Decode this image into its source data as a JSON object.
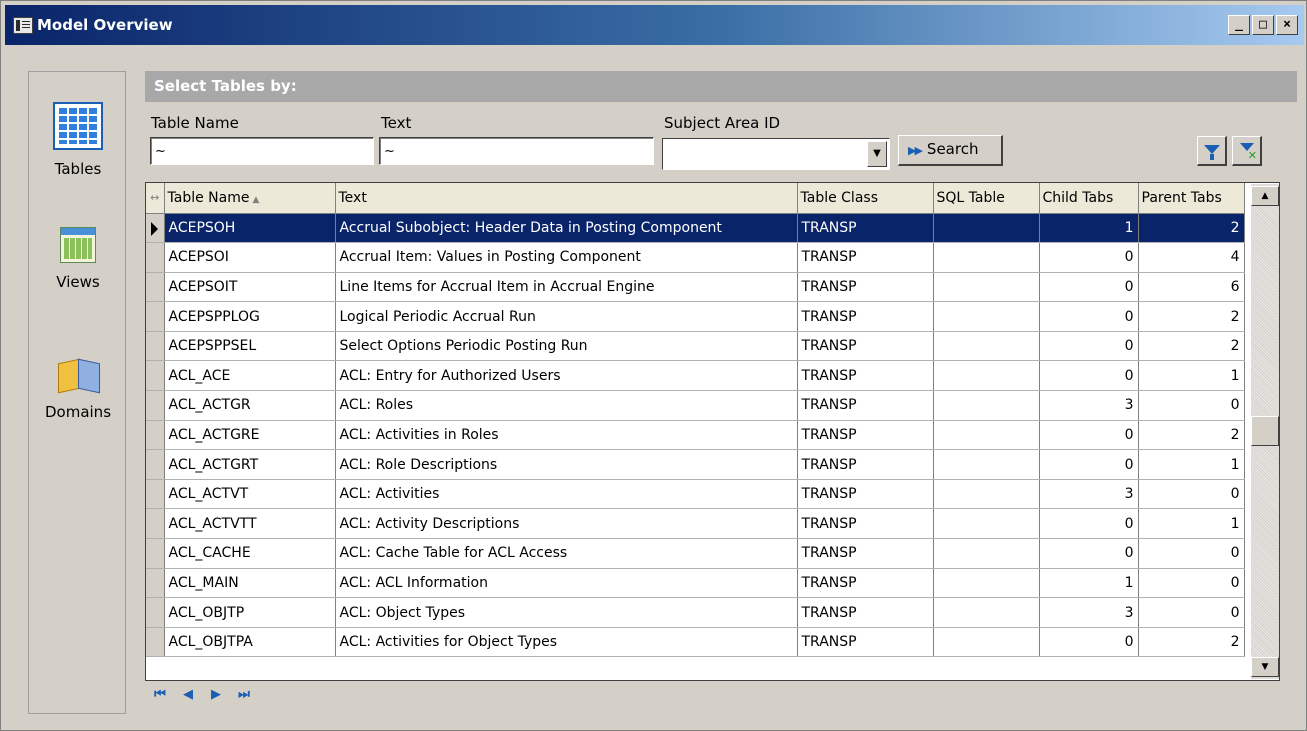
{
  "window": {
    "title": "Model Overview",
    "minimize": "_",
    "maximize": "□",
    "close": "×"
  },
  "leftnav": {
    "items": [
      {
        "label": "Tables",
        "icon": "tables-icon"
      },
      {
        "label": "Views",
        "icon": "views-icon"
      },
      {
        "label": "Domains",
        "icon": "domains-icon"
      }
    ]
  },
  "filter": {
    "header": "Select Tables by:",
    "table_name_label": "Table Name",
    "table_name_value": "~",
    "text_label": "Text",
    "text_value": "~",
    "subject_area_label": "Subject Area ID",
    "subject_area_value": "",
    "search_label": "Search"
  },
  "grid": {
    "columns": [
      "Table Name",
      "Text",
      "Table Class",
      "SQL Table",
      "Child Tabs",
      "Parent Tabs"
    ],
    "rows": [
      {
        "name": "ACEPSOH",
        "text": "Accrual Subobject: Header Data in Posting Component",
        "class": "TRANSP",
        "sql": "",
        "child": "1",
        "parent": "2"
      },
      {
        "name": "ACEPSOI",
        "text": "Accrual Item: Values in Posting Component",
        "class": "TRANSP",
        "sql": "",
        "child": "0",
        "parent": "4"
      },
      {
        "name": "ACEPSOIT",
        "text": "Line Items for Accrual Item in Accrual Engine",
        "class": "TRANSP",
        "sql": "",
        "child": "0",
        "parent": "6"
      },
      {
        "name": "ACEPSPPLOG",
        "text": "Logical Periodic Accrual Run",
        "class": "TRANSP",
        "sql": "",
        "child": "0",
        "parent": "2"
      },
      {
        "name": "ACEPSPPSEL",
        "text": "Select Options  Periodic Posting Run",
        "class": "TRANSP",
        "sql": "",
        "child": "0",
        "parent": "2"
      },
      {
        "name": "ACL_ACE",
        "text": "ACL: Entry for Authorized Users",
        "class": "TRANSP",
        "sql": "",
        "child": "0",
        "parent": "1"
      },
      {
        "name": "ACL_ACTGR",
        "text": "ACL: Roles",
        "class": "TRANSP",
        "sql": "",
        "child": "3",
        "parent": "0"
      },
      {
        "name": "ACL_ACTGRE",
        "text": "ACL: Activities in Roles",
        "class": "TRANSP",
        "sql": "",
        "child": "0",
        "parent": "2"
      },
      {
        "name": "ACL_ACTGRT",
        "text": "ACL: Role Descriptions",
        "class": "TRANSP",
        "sql": "",
        "child": "0",
        "parent": "1"
      },
      {
        "name": "ACL_ACTVT",
        "text": "ACL: Activities",
        "class": "TRANSP",
        "sql": "",
        "child": "3",
        "parent": "0"
      },
      {
        "name": "ACL_ACTVTT",
        "text": "ACL: Activity Descriptions",
        "class": "TRANSP",
        "sql": "",
        "child": "0",
        "parent": "1"
      },
      {
        "name": "ACL_CACHE",
        "text": "ACL: Cache Table for ACL Access",
        "class": "TRANSP",
        "sql": "",
        "child": "0",
        "parent": "0"
      },
      {
        "name": "ACL_MAIN",
        "text": "ACL: ACL Information",
        "class": "TRANSP",
        "sql": "",
        "child": "1",
        "parent": "0"
      },
      {
        "name": "ACL_OBJTP",
        "text": "ACL: Object Types",
        "class": "TRANSP",
        "sql": "",
        "child": "3",
        "parent": "0"
      },
      {
        "name": "ACL_OBJTPA",
        "text": "ACL: Activities for Object Types",
        "class": "TRANSP",
        "sql": "",
        "child": "0",
        "parent": "2"
      }
    ],
    "selected_row": 0
  },
  "pager": {
    "first": "first-page-icon",
    "prev": "prev-page-icon",
    "next": "next-page-icon",
    "last": "last-page-icon"
  },
  "colors": {
    "selection": "#0a246a",
    "accent": "#1a5fb4",
    "header_panel": "#a8a8a8"
  }
}
